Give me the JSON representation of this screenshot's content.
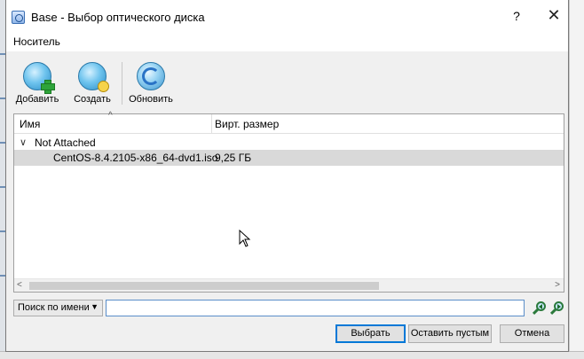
{
  "window": {
    "title": "Base - Выбор оптического диска",
    "help_glyph": "?",
    "close_glyph": "✕"
  },
  "menu": {
    "items": [
      "Носитель"
    ]
  },
  "toolbar": {
    "add_label": "Добавить",
    "create_label": "Создать",
    "refresh_label": "Обновить"
  },
  "table": {
    "columns": [
      "Имя",
      "Вирт. размер"
    ],
    "groups": [
      {
        "label": "Not Attached",
        "rows": [
          {
            "name": "CentOS-8.4.2105-x86_64-dvd1.iso",
            "size": "9,25 ГБ",
            "selected": true
          }
        ]
      }
    ]
  },
  "search": {
    "mode_label": "Поиск по имени",
    "value": ""
  },
  "buttons": {
    "choose": "Выбрать",
    "leave_empty": "Оставить пустым",
    "cancel": "Отмена"
  },
  "colors": {
    "accent": "#0078d7",
    "selection": "#d9d9d9",
    "icon_blue": "#2a8cc6",
    "icon_green": "#2ea43a"
  }
}
